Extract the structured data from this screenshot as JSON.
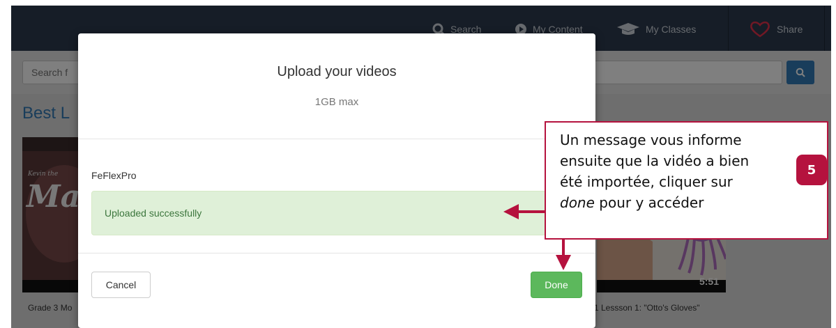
{
  "navbar": {
    "items": [
      {
        "label": "Search",
        "icon": "search-icon"
      },
      {
        "label": "My Content",
        "icon": "play-circle-icon"
      },
      {
        "label": "My Classes",
        "icon": "graduation-cap-icon"
      },
      {
        "label": "Share",
        "icon": "heart-icon"
      }
    ]
  },
  "search": {
    "placeholder": "Search f"
  },
  "page": {
    "section_title": "Best L",
    "videos": [
      {
        "caption": "Grade 3 Mo",
        "thumb_text": "Ma",
        "thumb_small_text": "Kevin the"
      },
      {
        "caption": "1 Lessson 1: \"Otto's Gloves\"",
        "duration": "5:51"
      }
    ]
  },
  "modal": {
    "title": "Upload your videos",
    "subtitle": "1GB max",
    "file_name": "FeFlexPro",
    "alert_text": "Uploaded successfully",
    "cancel_label": "Cancel",
    "done_label": "Done"
  },
  "annotation": {
    "step_number": "5",
    "lines": [
      "Un message vous informe",
      "ensuite que la vidéo a bien",
      "été importée, cliquer sur"
    ],
    "emphasis_word": "done",
    "tail_text": " pour y accéder"
  },
  "colors": {
    "navbar": "#2c3a4e",
    "accent": "#337ab7",
    "success": "#5cb85c",
    "annotation": "#b5123e"
  }
}
